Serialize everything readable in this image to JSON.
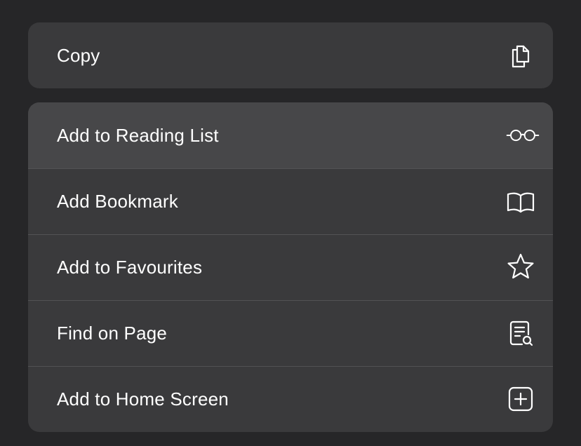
{
  "menu": {
    "copy_group": {
      "label": "Copy",
      "icon": "copy-icon"
    },
    "actions": [
      {
        "label": "Add to Reading List",
        "icon": "glasses-icon",
        "highlighted": true
      },
      {
        "label": "Add Bookmark",
        "icon": "book-icon",
        "highlighted": false
      },
      {
        "label": "Add to Favourites",
        "icon": "star-icon",
        "highlighted": false
      },
      {
        "label": "Find on Page",
        "icon": "find-document-icon",
        "highlighted": false
      },
      {
        "label": "Add to Home Screen",
        "icon": "plus-square-icon",
        "highlighted": false
      }
    ]
  },
  "colors": {
    "background": "#262628",
    "menu_surface": "#3a3a3c",
    "highlight": "#474749",
    "divider": "#525254",
    "text": "#ffffff"
  }
}
